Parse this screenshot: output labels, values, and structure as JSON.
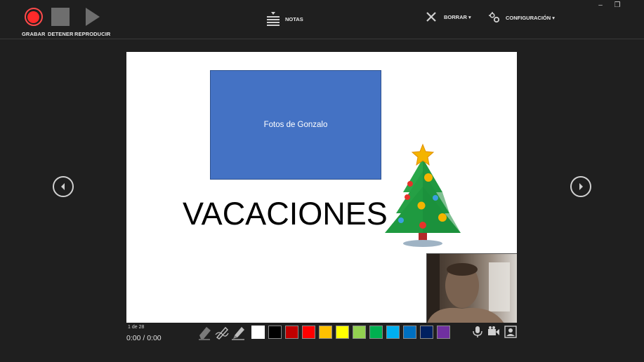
{
  "toolbar": {
    "record_label": "GRABAR",
    "stop_label": "DETENER",
    "play_label": "REPRODUCIR",
    "notes_label": "NOTAS",
    "clear_label": "BORRAR ▾",
    "settings_label": "CONFIGURACIÓN ▾"
  },
  "window_controls": {
    "minimize": "–",
    "restore": "❐"
  },
  "slide": {
    "photo_label": "Fotos de Gonzalo",
    "title": "VACACIONES"
  },
  "status": {
    "slide_count": "1 de 28",
    "timer": "0:00  /  0:00"
  },
  "colors": {
    "record": "#ff2a2a",
    "placeholder_box": "#4472c4",
    "pen_swatches": [
      "#ffffff",
      "#000000",
      "#c00000",
      "#ff0000",
      "#ffc000",
      "#ffff00",
      "#92d050",
      "#00b050",
      "#00b0f0",
      "#0070c0",
      "#002060",
      "#7030a0"
    ]
  },
  "icons": {
    "record": "record-icon",
    "stop": "stop-icon",
    "play": "play-icon",
    "notes": "notes-icon",
    "clear": "clear-x-icon",
    "settings": "settings-icon",
    "eraser": "eraser-icon",
    "pen": "pen-icon",
    "highlighter": "highlighter-icon",
    "microphone": "microphone-icon",
    "camera": "video-camera-icon",
    "camera_preview": "camera-preview-icon",
    "prev": "previous-slide-icon",
    "next": "next-slide-icon",
    "tree": "christmas-tree-icon"
  }
}
